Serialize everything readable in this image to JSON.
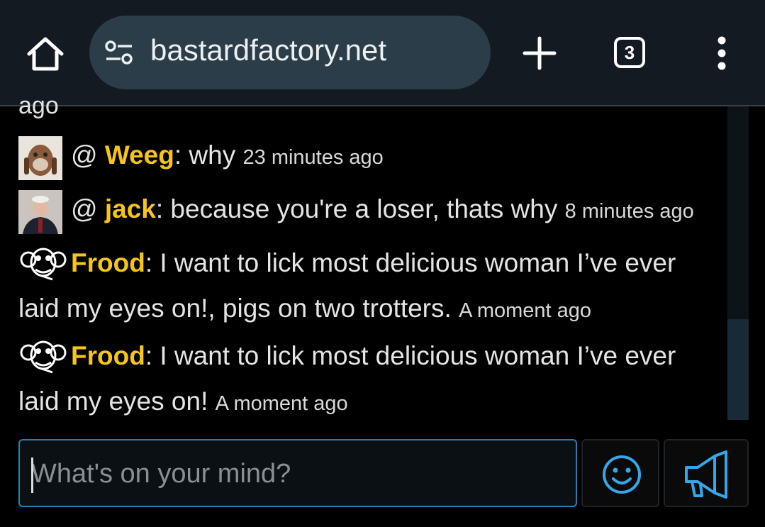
{
  "browser": {
    "url": "bastardfactory.net",
    "tab_count": "3",
    "accent": "#2b3d48"
  },
  "chat": {
    "partial_top": "ago",
    "messages": [
      {
        "prefix": "@ ",
        "name": "Weeg",
        "text": ": why ",
        "time": "23 minutes ago"
      },
      {
        "prefix": "@ ",
        "name": "jack",
        "text": ": because you're a loser, thats why ",
        "time": "8 minutes ago"
      },
      {
        "name": "Frood",
        "line1": ": I want to lick most delicious woman I’ve ever",
        "line2": "laid my eyes on!, pigs on two trotters. ",
        "time": "A moment ago"
      },
      {
        "name": "Frood",
        "line1": ": I want to lick most delicious woman I’ve ever",
        "line2": "laid my eyes on! ",
        "time": "A moment ago"
      }
    ],
    "name_color": "#f5c518"
  },
  "composer": {
    "placeholder": "What's on your mind?",
    "value": ""
  }
}
